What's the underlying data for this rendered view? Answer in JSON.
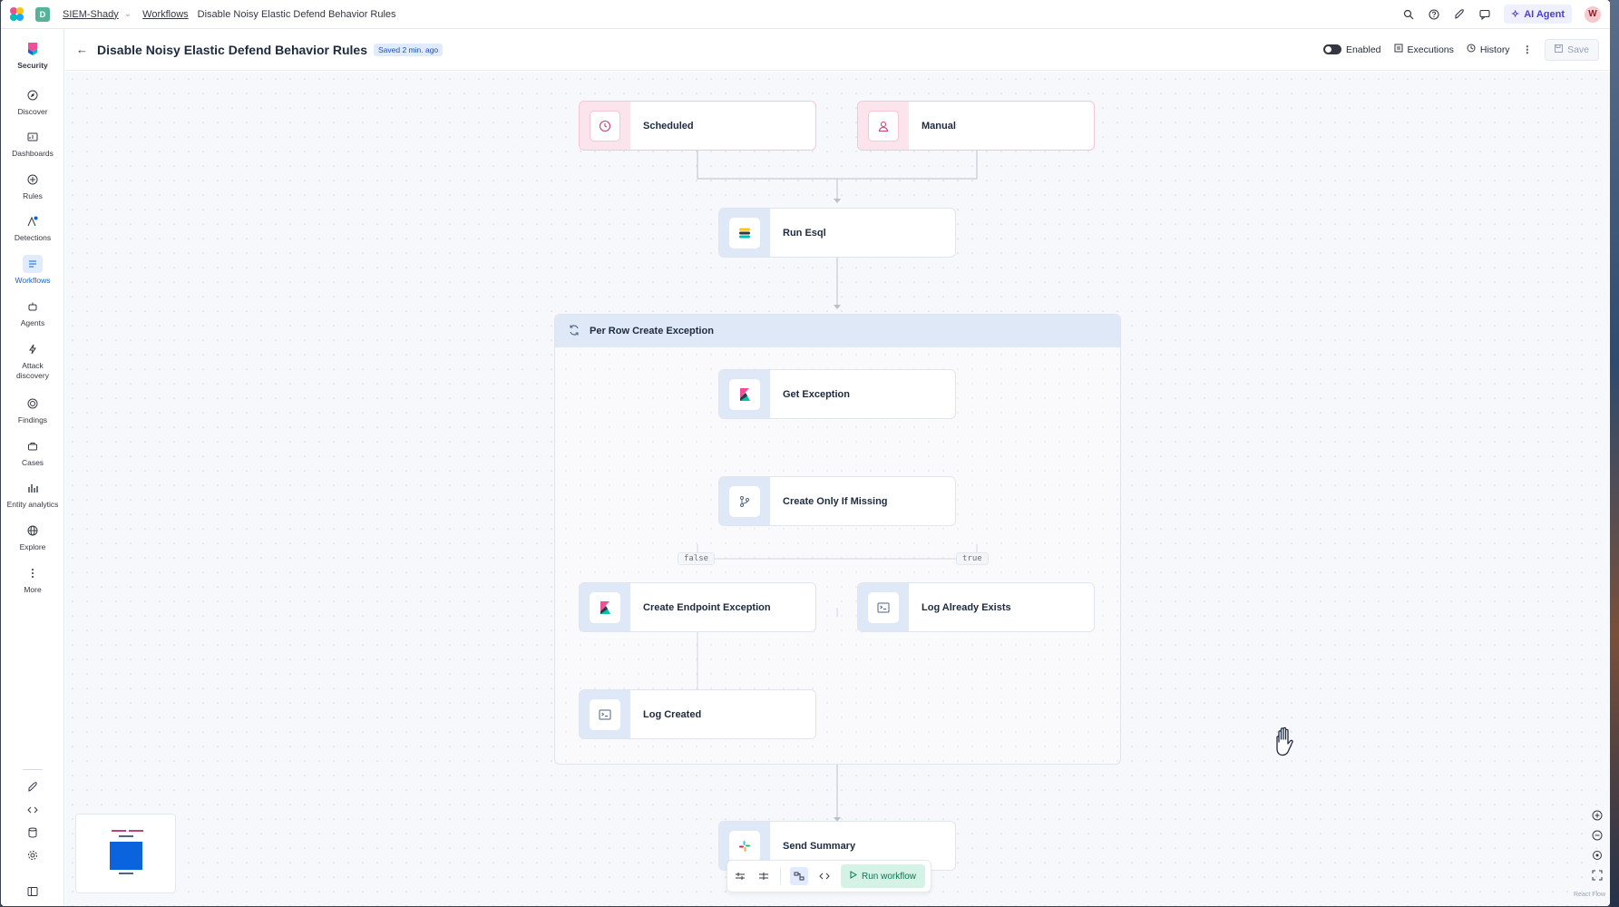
{
  "topbar": {
    "space_initial": "D",
    "breadcrumbs": [
      "SIEM-Shady",
      "Workflows",
      "Disable Noisy Elastic Defend Behavior Rules"
    ],
    "ai_agent_label": "AI Agent",
    "avatar_initial": "W"
  },
  "sidebar": {
    "items": [
      {
        "label": "Security",
        "icon": "security-logo-icon"
      },
      {
        "label": "Discover",
        "icon": "compass-icon"
      },
      {
        "label": "Dashboards",
        "icon": "dashboard-icon"
      },
      {
        "label": "Rules",
        "icon": "rules-icon"
      },
      {
        "label": "Detections",
        "icon": "alert-icon"
      },
      {
        "label": "Workflows",
        "icon": "workflow-icon"
      },
      {
        "label": "Agents",
        "icon": "agent-icon"
      },
      {
        "label": "Attack discovery",
        "icon": "bolt-icon"
      },
      {
        "label": "Findings",
        "icon": "target-icon"
      },
      {
        "label": "Cases",
        "icon": "briefcase-icon"
      },
      {
        "label": "Entity analytics",
        "icon": "bar-chart-icon"
      },
      {
        "label": "Explore",
        "icon": "globe-icon"
      },
      {
        "label": "More",
        "icon": "more-vertical-icon"
      }
    ]
  },
  "header": {
    "title": "Disable Noisy Elastic Defend Behavior Rules",
    "saved_badge": "Saved 2 min. ago",
    "enabled_label": "Enabled",
    "executions_label": "Executions",
    "history_label": "History",
    "save_label": "Save"
  },
  "workflow": {
    "triggers": [
      {
        "label": "Scheduled",
        "icon": "clock-icon"
      },
      {
        "label": "Manual",
        "icon": "user-icon"
      }
    ],
    "run_esql": "Run Esql",
    "group_title": "Per Row Create Exception",
    "get_exception": "Get Exception",
    "create_only_if_missing": "Create Only If Missing",
    "branch_false": "false",
    "branch_true": "true",
    "create_endpoint_exception": "Create Endpoint Exception",
    "log_already_exists": "Log Already Exists",
    "log_created": "Log Created",
    "send_summary": "Send Summary"
  },
  "toolbar": {
    "run_workflow": "Run workflow"
  },
  "react_flow_label": "React Flow"
}
